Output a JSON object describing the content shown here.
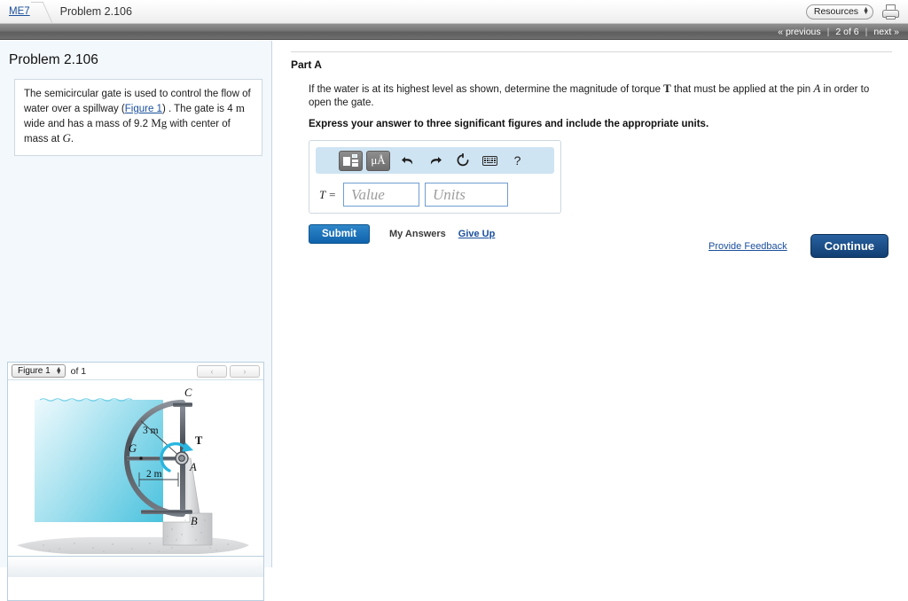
{
  "topbar": {
    "course_link": "ME7",
    "current_page": "Problem 2.106",
    "resources_label": "Resources",
    "print_icon": "printer-icon"
  },
  "navbar": {
    "previous": "« previous",
    "position": "2 of 6",
    "next": "next »",
    "divider": "|"
  },
  "sidebar": {
    "problem_title": "Problem 2.106",
    "statement_part1": "The semicircular gate is used to control the flow of water over a spillway (",
    "figure_link": "Figure 1",
    "statement_part2": ") . The gate is ",
    "width_value": "4",
    "width_unit": "m",
    "statement_part3": " wide and has a mass of ",
    "mass_value": "9.2",
    "mass_unit": "Mg",
    "statement_part4": " with center of mass at ",
    "center_label": "G",
    "statement_end": "."
  },
  "figure": {
    "selected": "Figure 1",
    "of_label": "of 1",
    "prev_arrow": "‹",
    "next_arrow": "›",
    "labels": {
      "point_c": "C",
      "point_g": "G",
      "point_a": "A",
      "point_b": "B",
      "torque": "T",
      "radius_dim": "3 m",
      "offset_dim": "2 m"
    },
    "colors": {
      "water_light": "#e8f7fb",
      "water_deep": "#4ec3de",
      "concrete": "#d9dadc",
      "gate_steel": "#5a5f66",
      "torque_arrow": "#29b6e0"
    }
  },
  "main": {
    "part_title": "Part A",
    "question_pre": "If the water is at its highest level as shown, determine the magnitude of torque ",
    "question_torque": "T",
    "question_mid": " that must be applied at the pin ",
    "question_pin": "A",
    "question_post": " in order to open the gate.",
    "instruction": "Express your answer to three significant figures and include the appropriate units.",
    "answer": {
      "variable_label": "T =",
      "value_placeholder": "Value",
      "value_text": "",
      "units_placeholder": "Units",
      "units_text": "",
      "toolbar": {
        "template_icon": "math-template-icon",
        "units_icon": "μÅ",
        "undo_icon": "↶",
        "redo_icon": "↷",
        "reset_icon": "↻",
        "keyboard_icon": "keyboard-icon",
        "help_icon": "?"
      }
    },
    "submit_label": "Submit",
    "my_answers_label": "My Answers",
    "give_up_label": "Give Up",
    "provide_feedback_label": "Provide Feedback",
    "continue_label": "Continue"
  }
}
